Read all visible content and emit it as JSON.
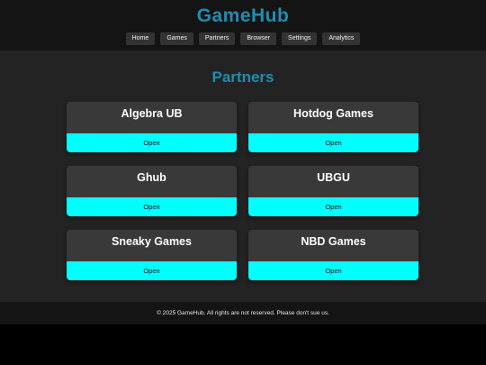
{
  "header": {
    "title": "GameHub",
    "nav": [
      "Home",
      "Games",
      "Partners",
      "Browser",
      "Settings",
      "Analytics"
    ]
  },
  "main": {
    "title": "Partners",
    "cards": [
      {
        "name": "Algebra UB",
        "action": "Open"
      },
      {
        "name": "Hotdog Games",
        "action": "Open"
      },
      {
        "name": "Ghub",
        "action": "Open"
      },
      {
        "name": "UBGU",
        "action": "Open"
      },
      {
        "name": "Sneaky Games",
        "action": "Open"
      },
      {
        "name": "NBD Games",
        "action": "Open"
      }
    ]
  },
  "footer": {
    "text": "© 2025 GameHub. All rights are not reserved. Please don't sue us."
  },
  "colors": {
    "accent": "#1c8fb0",
    "button": "#00ffff",
    "card": "#393939",
    "background": "#232323",
    "header": "#141414"
  }
}
